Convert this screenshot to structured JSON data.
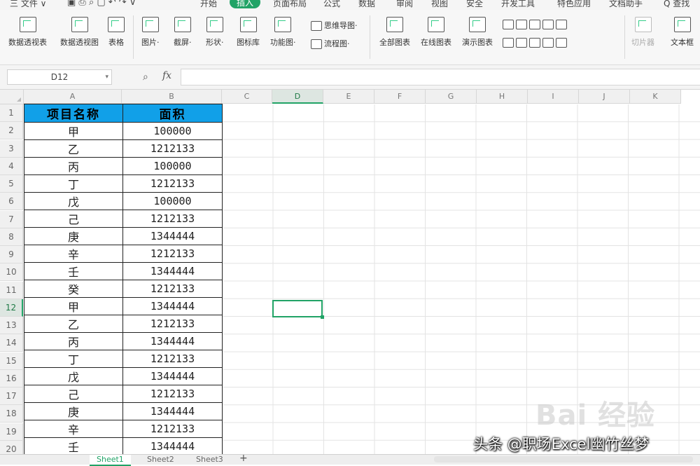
{
  "menu": {
    "file": "三 文件 ∨",
    "tabs": [
      "开始",
      "插入",
      "页面布局",
      "公式",
      "数据",
      "审阅",
      "视图",
      "安全",
      "开发工具",
      "特色应用",
      "文档助手"
    ],
    "active_tab": "插入",
    "search": "Q 查找"
  },
  "ribbon": {
    "pivot_table": "数据透视表",
    "pivot_chart": "数据透视图",
    "table": "表格",
    "picture": "图片·",
    "screenshot": "截屏·",
    "shapes": "形状·",
    "icons": "图标库",
    "function_chart": "功能图·",
    "mind_map": "思维导图·",
    "flow_chart": "流程图·",
    "all_charts": "全部图表",
    "online_charts": "在线图表",
    "chart_templates": "演示图表",
    "slicer": "切片器",
    "textbox": "文本框"
  },
  "formula_bar": {
    "name_box": "D12",
    "fx": "fx",
    "formula": ""
  },
  "columns": [
    "A",
    "B",
    "C",
    "D",
    "E",
    "F",
    "G",
    "H",
    "I",
    "J",
    "K"
  ],
  "selected_column": "D",
  "rows": [
    "1",
    "2",
    "3",
    "4",
    "5",
    "6",
    "7",
    "8",
    "9",
    "10",
    "11",
    "12",
    "13",
    "14",
    "15",
    "16",
    "17",
    "18",
    "19",
    "20"
  ],
  "selected_row": "12",
  "table": {
    "header_name": "项目名称",
    "header_area": "面积",
    "header_color": "#11a0e8",
    "data": [
      {
        "name": "甲",
        "area": "100000"
      },
      {
        "name": "乙",
        "area": "1212133"
      },
      {
        "name": "丙",
        "area": "100000"
      },
      {
        "name": "丁",
        "area": "1212133"
      },
      {
        "name": "戊",
        "area": "100000"
      },
      {
        "name": "己",
        "area": "1212133"
      },
      {
        "name": "庚",
        "area": "1344444"
      },
      {
        "name": "辛",
        "area": "1212133"
      },
      {
        "name": "壬",
        "area": "1344444"
      },
      {
        "name": "癸",
        "area": "1212133"
      },
      {
        "name": "甲",
        "area": "1344444"
      },
      {
        "name": "乙",
        "area": "1212133"
      },
      {
        "name": "丙",
        "area": "1344444"
      },
      {
        "name": "丁",
        "area": "1212133"
      },
      {
        "name": "戊",
        "area": "1344444"
      },
      {
        "name": "己",
        "area": "1212133"
      },
      {
        "name": "庚",
        "area": "1344444"
      },
      {
        "name": "辛",
        "area": "1212133"
      },
      {
        "name": "壬",
        "area": "1344444"
      }
    ]
  },
  "sheet_tabs": [
    "Sheet1",
    "Sheet2",
    "Sheet3"
  ],
  "active_sheet": "Sheet1",
  "add_sheet": "+",
  "accent_color": "#21a366",
  "watermark": "Bai 经验",
  "caption": "头条 @职场Excel幽竹丝梦"
}
